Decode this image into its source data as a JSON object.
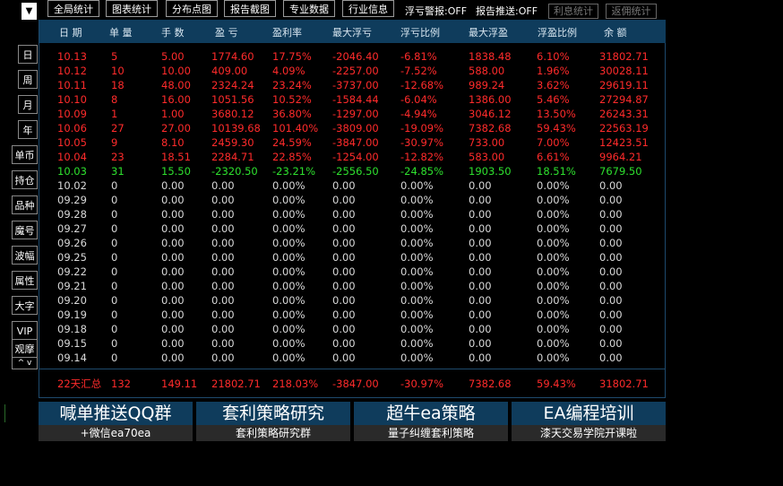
{
  "toolbar": {
    "dropdown": "▼",
    "buttons": [
      "全局统计",
      "图表统计",
      "分布点图",
      "报告截图",
      "专业数据",
      "行业信息"
    ],
    "alert_status": "浮亏警报:OFF",
    "report_status": "报告推送:OFF",
    "interest_stats": "利息统计",
    "rebate_stats": "返佣统计"
  },
  "sidebar": {
    "periods": [
      "日",
      "周",
      "月",
      "年"
    ],
    "items": [
      "单币",
      "持仓",
      "品种",
      "魔号",
      "波幅",
      "属性",
      "大字",
      "VIP",
      "观摩"
    ],
    "scroll": "^ v"
  },
  "table": {
    "columns": [
      "日 期",
      "单 量",
      "手 数",
      "盈 亏",
      "盈利率",
      "最大浮亏",
      "浮亏比例",
      "最大浮盈",
      "浮盈比例",
      "余 额"
    ],
    "rows": [
      {
        "color": "red",
        "cells": [
          "10.13",
          "5",
          "5.00",
          "1774.60",
          "17.75%",
          "-2046.40",
          "-6.81%",
          "1838.48",
          "6.10%",
          "31802.71"
        ]
      },
      {
        "color": "red",
        "cells": [
          "10.12",
          "10",
          "10.00",
          "409.00",
          "4.09%",
          "-2257.00",
          "-7.52%",
          "588.00",
          "1.96%",
          "30028.11"
        ]
      },
      {
        "color": "red",
        "cells": [
          "10.11",
          "18",
          "48.00",
          "2324.24",
          "23.24%",
          "-3737.00",
          "-12.68%",
          "989.24",
          "3.62%",
          "29619.11"
        ]
      },
      {
        "color": "red",
        "cells": [
          "10.10",
          "8",
          "16.00",
          "1051.56",
          "10.52%",
          "-1584.44",
          "-6.04%",
          "1386.00",
          "5.46%",
          "27294.87"
        ]
      },
      {
        "color": "red",
        "cells": [
          "10.09",
          "1",
          "1.00",
          "3680.12",
          "36.80%",
          "-1297.00",
          "-4.94%",
          "3046.12",
          "13.50%",
          "26243.31"
        ]
      },
      {
        "color": "red",
        "cells": [
          "10.06",
          "27",
          "27.00",
          "10139.68",
          "101.40%",
          "-3809.00",
          "-19.09%",
          "7382.68",
          "59.43%",
          "22563.19"
        ]
      },
      {
        "color": "red",
        "cells": [
          "10.05",
          "9",
          "8.10",
          "2459.30",
          "24.59%",
          "-3847.00",
          "-30.97%",
          "733.00",
          "7.00%",
          "12423.51"
        ]
      },
      {
        "color": "red",
        "cells": [
          "10.04",
          "23",
          "18.51",
          "2284.71",
          "22.85%",
          "-1254.00",
          "-12.82%",
          "583.00",
          "6.61%",
          "9964.21"
        ]
      },
      {
        "color": "green",
        "cells": [
          "10.03",
          "31",
          "15.50",
          "-2320.50",
          "-23.21%",
          "-2556.50",
          "-24.85%",
          "1903.50",
          "18.51%",
          "7679.50"
        ]
      },
      {
        "color": "white",
        "cells": [
          "10.02",
          "0",
          "0.00",
          "0.00",
          "0.00%",
          "0.00",
          "0.00%",
          "0.00",
          "0.00%",
          "0.00"
        ]
      },
      {
        "color": "white",
        "cells": [
          "09.29",
          "0",
          "0.00",
          "0.00",
          "0.00%",
          "0.00",
          "0.00%",
          "0.00",
          "0.00%",
          "0.00"
        ]
      },
      {
        "color": "white",
        "cells": [
          "09.28",
          "0",
          "0.00",
          "0.00",
          "0.00%",
          "0.00",
          "0.00%",
          "0.00",
          "0.00%",
          "0.00"
        ]
      },
      {
        "color": "white",
        "cells": [
          "09.27",
          "0",
          "0.00",
          "0.00",
          "0.00%",
          "0.00",
          "0.00%",
          "0.00",
          "0.00%",
          "0.00"
        ]
      },
      {
        "color": "white",
        "cells": [
          "09.26",
          "0",
          "0.00",
          "0.00",
          "0.00%",
          "0.00",
          "0.00%",
          "0.00",
          "0.00%",
          "0.00"
        ]
      },
      {
        "color": "white",
        "cells": [
          "09.25",
          "0",
          "0.00",
          "0.00",
          "0.00%",
          "0.00",
          "0.00%",
          "0.00",
          "0.00%",
          "0.00"
        ]
      },
      {
        "color": "white",
        "cells": [
          "09.22",
          "0",
          "0.00",
          "0.00",
          "0.00%",
          "0.00",
          "0.00%",
          "0.00",
          "0.00%",
          "0.00"
        ]
      },
      {
        "color": "white",
        "cells": [
          "09.21",
          "0",
          "0.00",
          "0.00",
          "0.00%",
          "0.00",
          "0.00%",
          "0.00",
          "0.00%",
          "0.00"
        ]
      },
      {
        "color": "white",
        "cells": [
          "09.20",
          "0",
          "0.00",
          "0.00",
          "0.00%",
          "0.00",
          "0.00%",
          "0.00",
          "0.00%",
          "0.00"
        ]
      },
      {
        "color": "white",
        "cells": [
          "09.19",
          "0",
          "0.00",
          "0.00",
          "0.00%",
          "0.00",
          "0.00%",
          "0.00",
          "0.00%",
          "0.00"
        ]
      },
      {
        "color": "white",
        "cells": [
          "09.18",
          "0",
          "0.00",
          "0.00",
          "0.00%",
          "0.00",
          "0.00%",
          "0.00",
          "0.00%",
          "0.00"
        ]
      },
      {
        "color": "white",
        "cells": [
          "09.15",
          "0",
          "0.00",
          "0.00",
          "0.00%",
          "0.00",
          "0.00%",
          "0.00",
          "0.00%",
          "0.00"
        ]
      },
      {
        "color": "white",
        "cells": [
          "09.14",
          "0",
          "0.00",
          "0.00",
          "0.00%",
          "0.00",
          "0.00%",
          "0.00",
          "0.00%",
          "0.00"
        ]
      }
    ],
    "summary": [
      "22天汇总",
      "132",
      "149.11",
      "21802.71",
      "218.03%",
      "-3847.00",
      "-30.97%",
      "7382.68",
      "59.43%",
      "31802.71"
    ]
  },
  "banners": [
    {
      "title": "喊单推送QQ群",
      "sub": "+微信ea70ea"
    },
    {
      "title": "套利策略研究",
      "sub": "套利策略研究群"
    },
    {
      "title": "超牛ea策略",
      "sub": "量子纠缠套利策略"
    },
    {
      "title": "EA编程培训",
      "sub": "漆天交易学院开课啦"
    }
  ],
  "colors": {
    "profit": "#ff2b2b",
    "loss": "#2ee02e",
    "neutral": "#d9d9d9",
    "header_bg": "#0f3c5c"
  }
}
